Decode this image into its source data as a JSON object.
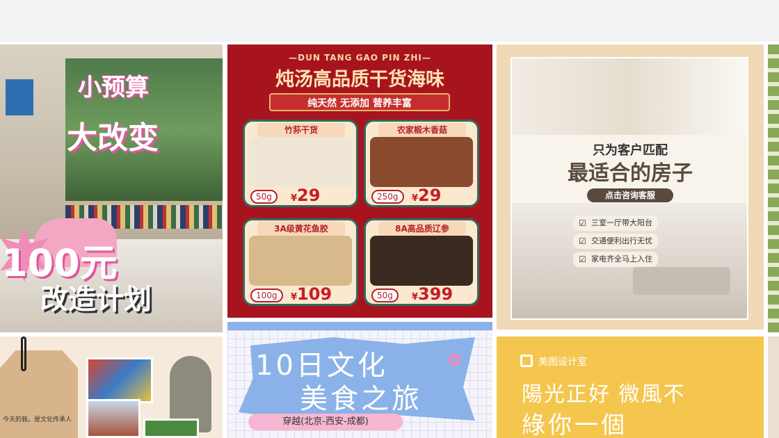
{
  "cards": {
    "makeover": {
      "line1": "小预算",
      "line2": "大改变",
      "line3": "100元",
      "line4": "改造计划"
    },
    "seafood": {
      "subtitle": "—DUN TANG GAO PIN ZHI—",
      "title": "炖汤高品质干货海味",
      "ribbon": "纯天然 无添加 营养丰富",
      "currency": "¥",
      "products": [
        {
          "name": "竹荪干货",
          "weight": "50g",
          "price": "29",
          "color": "#efe6d6"
        },
        {
          "name": "农家椴木香菇",
          "weight": "250g",
          "price": "29",
          "color": "#8a4a2e"
        },
        {
          "name": "3A级黄花鱼胶",
          "weight": "100g",
          "price": "109",
          "color": "#d8b98c"
        },
        {
          "name": "8A高品质辽参",
          "weight": "50g",
          "price": "399",
          "color": "#3a2a22"
        }
      ]
    },
    "house": {
      "sub": "只为客户匹配",
      "title": "最适合的房子",
      "button": "点击咨询客服",
      "features": [
        "三室一厅带大阳台",
        "交通便利出行无忧",
        "家电齐全马上入住"
      ]
    },
    "travel_notes": {
      "note": "今天的我，是文化传承人"
    },
    "culture_trip": {
      "line1": "10日文化",
      "line2": "美食之旅",
      "route": "穿越(北京-西安-成都)",
      "flower": "✿"
    },
    "sunny": {
      "brand": "美图设计室",
      "line1": "陽光正好 微風不",
      "line2": "綠你一個"
    }
  }
}
